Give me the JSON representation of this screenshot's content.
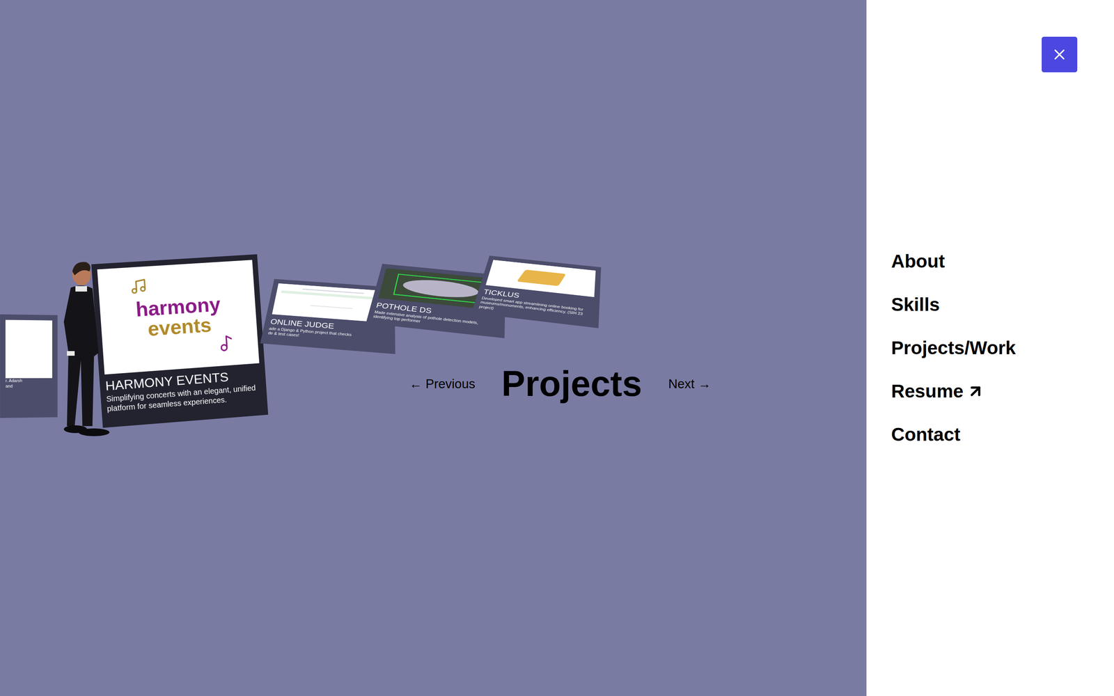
{
  "nav": {
    "previous": "← Previous",
    "title": "Projects",
    "next": "Next →"
  },
  "projects": [
    {
      "kind": "blank",
      "title": "",
      "description": "r. Adarsh\nand",
      "focused": false
    },
    {
      "kind": "logo",
      "logo": [
        "harmony",
        "events"
      ],
      "title": "HARMONY EVENTS",
      "description": "Simplifying concerts with an elegant, unified platform for seamless experiences.",
      "focused": true
    },
    {
      "kind": "screen",
      "title": "ONLINE JUDGE",
      "description": "ade a Django & Python project that checks\nde & test cases!",
      "focused": false
    },
    {
      "kind": "photo",
      "title": "POTHOLE DS",
      "description": "Made extensive analysis of pothole detection models, identifying top performer",
      "focused": false
    },
    {
      "kind": "object",
      "title": "TICKLUS",
      "description": "Developed smart app streamlining online booking for museums/monuments, enhancing efficiency. (SIH 23 project)",
      "focused": false
    }
  ],
  "menu": [
    {
      "label": "About",
      "external": false
    },
    {
      "label": "Skills",
      "external": false
    },
    {
      "label": "Projects/Work",
      "external": false
    },
    {
      "label": "Resume",
      "external": true
    },
    {
      "label": "Contact",
      "external": false
    }
  ]
}
